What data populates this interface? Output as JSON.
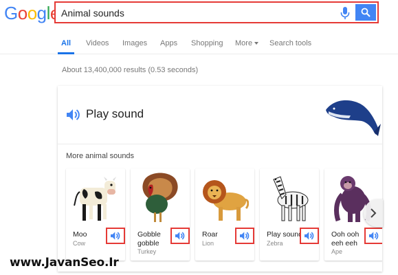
{
  "logo": {
    "letters": [
      "G",
      "o",
      "o",
      "g",
      "l",
      "e"
    ]
  },
  "search": {
    "query": "Animal sounds"
  },
  "tabs": [
    {
      "label": "All",
      "active": true
    },
    {
      "label": "Videos",
      "active": false
    },
    {
      "label": "Images",
      "active": false
    },
    {
      "label": "Apps",
      "active": false
    },
    {
      "label": "Shopping",
      "active": false
    },
    {
      "label": "More",
      "active": false
    },
    {
      "label": "Search tools",
      "active": false
    }
  ],
  "result_stats": "About 13,400,000 results (0.53 seconds)",
  "card": {
    "play_label": "Play sound",
    "more_title": "More animal sounds",
    "animals": [
      {
        "sound": "Moo",
        "name": "Cow"
      },
      {
        "sound": "Gobble gobble",
        "name": "Turkey"
      },
      {
        "sound": "Roar",
        "name": "Lion"
      },
      {
        "sound": "Play sound",
        "name": "Zebra"
      },
      {
        "sound": "Ooh ooh eeh eeh",
        "name": "Ape"
      }
    ]
  },
  "watermark": "www.JavanSeo.Ir",
  "colors": {
    "accent": "#4285f4",
    "highlight_border": "#e53935",
    "active_tab": "#1a73e8"
  },
  "icons": {
    "mic": "microphone-icon",
    "search": "search-icon",
    "speaker": "speaker-icon",
    "next": "chevron-right-icon"
  }
}
